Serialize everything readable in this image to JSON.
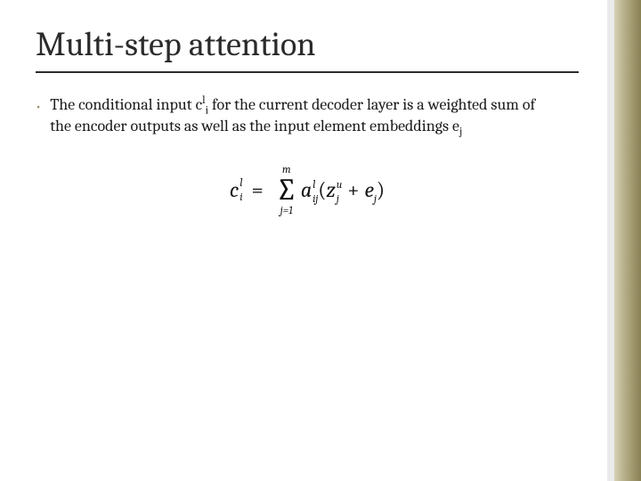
{
  "slide": {
    "title": "Multi-step attention",
    "bullet": {
      "pre": "The conditional input ",
      "var1_base": "c",
      "var1_sup": "l",
      "var1_sub": "i",
      "mid": " for the current decoder layer is a weighted sum of the encoder outputs as well as the input element embeddings ",
      "var2_base": "e",
      "var2_sub": "j"
    },
    "formula": {
      "lhs_base": "c",
      "lhs_sup": "l",
      "lhs_sub": "i",
      "eq": "=",
      "sum_top": "m",
      "sum_bot": "j=1",
      "a_base": "a",
      "a_sup": "l",
      "a_sub": "ij",
      "lparen": "(",
      "z_base": "z",
      "z_sup": "u",
      "z_sub": "j",
      "plus": "+",
      "e_base": "e",
      "e_sub": "j",
      "rparen": ")"
    }
  }
}
